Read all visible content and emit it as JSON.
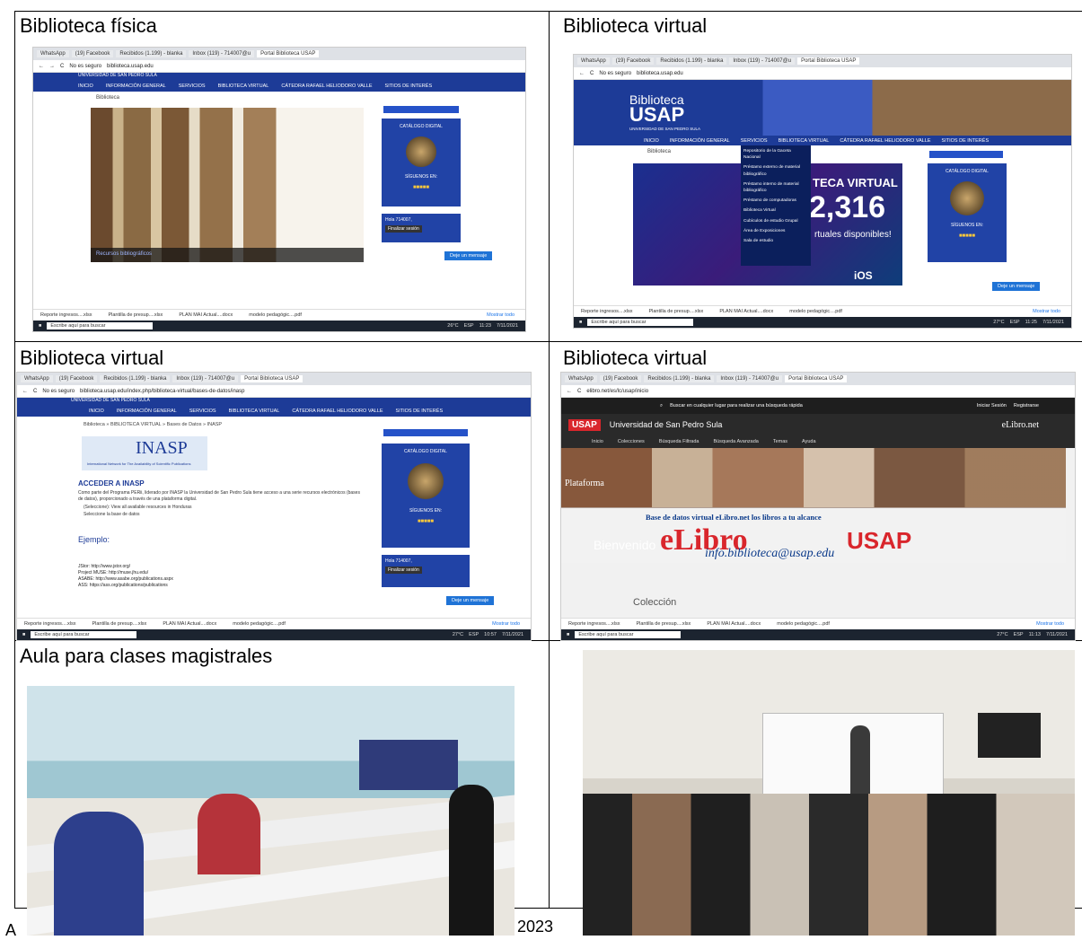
{
  "captions": {
    "c1": "Biblioteca física",
    "c2": "Biblioteca virtual",
    "c3": "Biblioteca virtual",
    "c4": "Biblioteca virtual",
    "c5": "Aula para clases magistrales"
  },
  "browser": {
    "tabs": [
      "WhatsApp",
      "(19) Facebook",
      "Recibidos (1.199) - blanka",
      "Inbox (119) - 714007@u",
      "Portal Biblioteca USAP"
    ],
    "url": "biblioteca.usap.edu",
    "url_inasp": "biblioteca.usap.edu/index.php/biblioteca-virtual/bases-de-datos/inasp",
    "url_elibro": "elibro.net/es/lc/usap/inicio",
    "not_secure": "No es seguro"
  },
  "site": {
    "university": "UNIVERSIDAD DE SAN PEDRO SULA",
    "nav": [
      "INICIO",
      "INFORMACIÓN GENERAL",
      "SERVICIOS",
      "BIBLIOTECA VIRTUAL",
      "CÁTEDRA RAFAEL HELIODORO VALLE",
      "SITIOS DE INTERÉS"
    ],
    "breadcrumb": "Biblioteca",
    "catalog": "CATÁLOGO DIGITAL",
    "follow": "SÍGUENOS EN:",
    "login_user": "Hola 714007,",
    "logout": "Finalizar sesión",
    "message": "Deje un mensaje",
    "resources": "Recursos bibliográficos",
    "logo_small": "Biblioteca",
    "logo_big": "USAP",
    "logo_sub": "UNIVERSIDAD DE SAN PEDRO SULA",
    "banner_title": "TECA VIRTUAL",
    "banner_number": "2,316",
    "banner_sub": "rtuales disponibles!",
    "ios": "iOS",
    "services_menu": [
      "Repositorio de la Gaceta Nacional",
      "Préstamo externo de material bibliográfico",
      "Préstamo interno de material bibliográfico",
      "Préstamo de computadoras",
      "Biblioteca Virtual",
      "Cubículos de estudio Grupal",
      "Área de Exposiciones",
      "Sala de estudio"
    ]
  },
  "inasp": {
    "breadcrumb": "Biblioteca » BIBLIOTECA VIRTUAL » Bases de Datos » INASP",
    "logo": "INASP",
    "network": "International Network for The Availability of Scientific Publications",
    "heading": "ACCEDER A INASP",
    "body": "Como parte del Programa PERii, liderado por INASP la Universidad de San Pedro Sula tiene acceso a una serie recursos electrónicos (bases de datos), proporcionado a través de una plataforma digital.",
    "bullet1": "(Seleccione): View all available resources in Honduras",
    "bullet2": "Seleccione la base de datos",
    "example": "Ejemplo:",
    "jstor": "JStor: http://www.jstor.org/",
    "muse": "Project MUSE: http://muse.jhu.edu/",
    "asabe": "ASABE: http://www.asabe.org/publications.aspx",
    "ass": "ASS: https://ass.org/publications/publications"
  },
  "elibro": {
    "search": "Buscar en cualquier lugar para realizar una búsqueda rápida",
    "login": "Iniciar Sesión",
    "register": "Registrarse",
    "usap": "USAP",
    "university": "Universidad de San Pedro Sula",
    "brand": "eLibro.net",
    "menu": [
      "Inicio",
      "Colecciones",
      "Búsqueda Filtrada",
      "Búsqueda Avanzada",
      "Temas",
      "Ayuda"
    ],
    "platform": "Plataforma",
    "tagline": "Base de datos virtual eLibro.net los libros a tu alcance",
    "big_left": "eLibro",
    "big_right": "USAP",
    "welcome": "Bienvenido",
    "email": "info.biblioteca@usap.edu",
    "collection": "Colección"
  },
  "downloads": [
    "Reporte ingresos....xlsx",
    "Plantilla de presup....xlsx",
    "PLAN MAI Actual....docx",
    "modelo pedagógic....pdf"
  ],
  "show_all": "Mostrar todo",
  "taskbar": {
    "search": "Escribe aquí para buscar",
    "temp1": "26°C",
    "temp2": "27°C",
    "lang": "ESP",
    "time1": "11:23",
    "time2": "11:25",
    "time3": "10:57",
    "time4": "11:13",
    "date": "7/11/2021"
  },
  "footer_fragment": "2023",
  "footer_fragment_left": "A"
}
